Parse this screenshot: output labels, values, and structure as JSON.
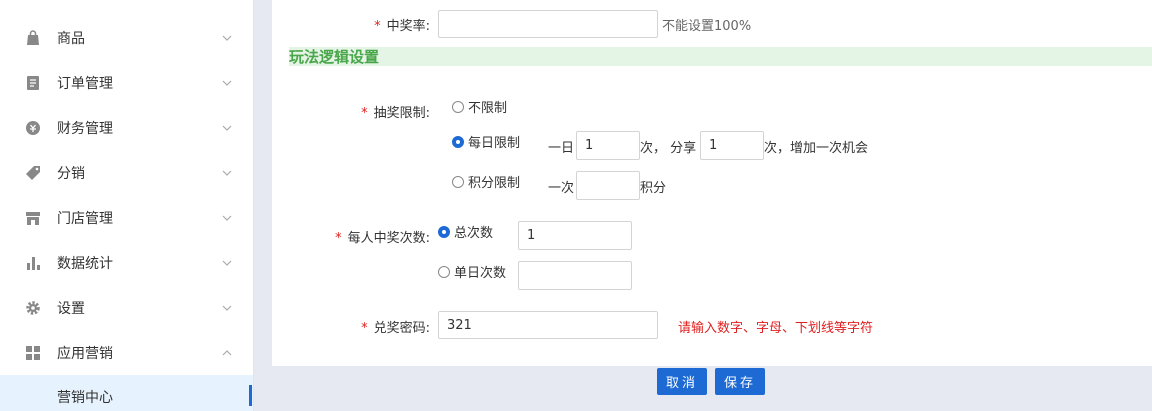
{
  "sidebar": {
    "items": [
      {
        "label": "商品",
        "icon": "bag-icon"
      },
      {
        "label": "订单管理",
        "icon": "order-icon"
      },
      {
        "label": "财务管理",
        "icon": "finance-icon"
      },
      {
        "label": "分销",
        "icon": "tag-icon"
      },
      {
        "label": "门店管理",
        "icon": "store-icon"
      },
      {
        "label": "数据统计",
        "icon": "chart-icon"
      },
      {
        "label": "设置",
        "icon": "gear-icon"
      },
      {
        "label": "应用营销",
        "icon": "apps-icon"
      }
    ],
    "active_sub": "营销中心"
  },
  "form": {
    "win_rate": {
      "label": "中奖率:",
      "value": "",
      "hint": "不能设置100%"
    },
    "section_title": "玩法逻辑设置",
    "draw_limit": {
      "label": "抽奖限制:",
      "options": [
        "不限制",
        "每日限制",
        "积分限制"
      ],
      "selected": "每日限制",
      "daily_prefix": "一日",
      "daily_value": "1",
      "daily_mid": "次， 分享",
      "share_value": "1",
      "daily_suffix": "次，增加一次机会",
      "points_prefix": "一次",
      "points_value": "",
      "points_suffix": "积分"
    },
    "win_count": {
      "label": "每人中奖次数:",
      "options": [
        "总次数",
        "单日次数"
      ],
      "selected": "总次数",
      "total_value": "1",
      "daily_value": ""
    },
    "password": {
      "label": "兑奖密码:",
      "value": "321",
      "hint": "请输入数字、字母、下划线等字符"
    },
    "asterisk": "*"
  },
  "buttons": {
    "cancel": "取消",
    "save": "保存"
  },
  "colors": {
    "primary": "#1e6ad4",
    "required": "#e02020",
    "section": "#4aa64a",
    "section_bg": "#e5f5e5"
  }
}
